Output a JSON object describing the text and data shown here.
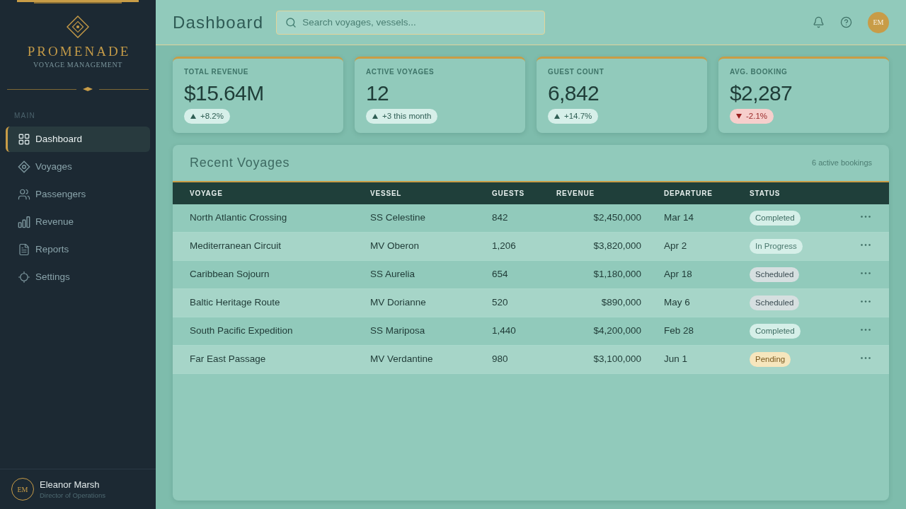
{
  "sidebar": {
    "brand": {
      "name": "PROMENADE",
      "tagline": "VOYAGE MANAGEMENT"
    },
    "section_label": "MAIN",
    "items": [
      {
        "label": "Dashboard",
        "selected": true
      },
      {
        "label": "Voyages",
        "selected": false
      },
      {
        "label": "Passengers",
        "selected": false
      },
      {
        "label": "Revenue",
        "selected": false
      },
      {
        "label": "Reports",
        "selected": false
      },
      {
        "label": "Settings",
        "selected": false
      }
    ],
    "user": {
      "initials": "EM",
      "name": "Eleanor Marsh",
      "role": "Director of Operations"
    }
  },
  "header": {
    "title": "Dashboard",
    "search": {
      "placeholder": "Search voyages, vessels..."
    },
    "avatar_initials": "EM"
  },
  "stats": [
    {
      "label": "TOTAL REVENUE",
      "value": "$15.64M",
      "change": {
        "text": "+8.2%",
        "kind": "up"
      }
    },
    {
      "label": "ACTIVE VOYAGES",
      "value": "12",
      "change": {
        "text": "+3 this month",
        "kind": "up"
      }
    },
    {
      "label": "GUEST COUNT",
      "value": "6,842",
      "change": {
        "text": "+14.7%",
        "kind": "up"
      }
    },
    {
      "label": "AVG. BOOKING",
      "value": "$2,287",
      "change": {
        "text": "-2.1%",
        "kind": "down"
      }
    }
  ],
  "voyages_panel": {
    "title": "Recent Voyages",
    "summary": "6 active bookings",
    "table": {
      "columns": [
        "VOYAGE",
        "VESSEL",
        "GUESTS",
        "REVENUE",
        "DEPARTURE",
        "STATUS"
      ],
      "rows": [
        {
          "voyage": "North Atlantic Crossing",
          "vessel": "SS Celestine",
          "guests": "842",
          "revenue": "$2,450,000",
          "departure": "Mar 14",
          "status": {
            "label": "Completed",
            "kind": "completed"
          }
        },
        {
          "voyage": "Mediterranean Circuit",
          "vessel": "MV Oberon",
          "guests": "1,206",
          "revenue": "$3,820,000",
          "departure": "Apr 2",
          "status": {
            "label": "In Progress",
            "kind": "in_progress"
          }
        },
        {
          "voyage": "Caribbean Sojourn",
          "vessel": "SS Aurelia",
          "guests": "654",
          "revenue": "$1,180,000",
          "departure": "Apr 18",
          "status": {
            "label": "Scheduled",
            "kind": "scheduled"
          }
        },
        {
          "voyage": "Baltic Heritage Route",
          "vessel": "MV Dorianne",
          "guests": "520",
          "revenue": "$890,000",
          "departure": "May 6",
          "status": {
            "label": "Scheduled",
            "kind": "scheduled"
          }
        },
        {
          "voyage": "South Pacific Expedition",
          "vessel": "SS Mariposa",
          "guests": "1,440",
          "revenue": "$4,200,000",
          "departure": "Feb 28",
          "status": {
            "label": "Completed",
            "kind": "completed"
          }
        },
        {
          "voyage": "Far East Passage",
          "vessel": "MV Verdantine",
          "guests": "980",
          "revenue": "$3,100,000",
          "departure": "Jun 1",
          "status": {
            "label": "Pending",
            "kind": "pending"
          }
        }
      ]
    }
  }
}
